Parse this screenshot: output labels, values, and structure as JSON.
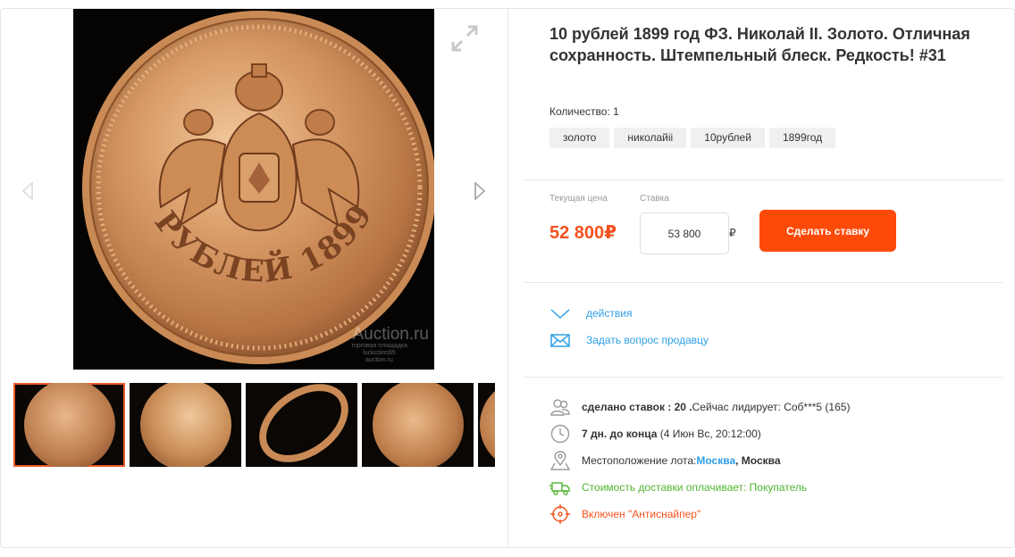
{
  "lot": {
    "title": "10 рублей 1899 год ФЗ. Николай II. Золото. Отличная сохранность. Штемпельный блеск. Редкость! #31",
    "quantity_label": "Количество: 1",
    "tags": [
      "золото",
      "николайii",
      "10рублей",
      "1899год"
    ]
  },
  "photo": {
    "coin_legend": "10 РУБЛЕЙ 1899 Г.",
    "watermark": "Auction.ru",
    "watermark_sub1": "торговая площадка",
    "watermark_sub2": "luckcoins95",
    "watermark_sub3": "auction.ru"
  },
  "bidding": {
    "current_price_label": "Текущая цена",
    "bid_label": "Ставка",
    "current_price": "52 800₽",
    "bid_value": "53 800",
    "currency_sign": "₽",
    "bid_button": "Сделать ставку"
  },
  "actions": {
    "actions_link": "действия",
    "ask_seller": "Задать вопрос продавцу"
  },
  "details": {
    "bids_count": "сделано ставок : 20 .",
    "leader": "Сейчас лидирует: Соб***5 (165)",
    "time_left": "7 дн. до конца",
    "end_date": "(4 Июн Вс, 20:12:00)",
    "location_label": "Местоположение лота:",
    "location_region": "Москва",
    "location_city": ", Москва",
    "shipping": "Стоимость доставки оплачивает: Покупатель",
    "antisniper": "Включен \"Антиснайпер\""
  },
  "colors": {
    "accent": "#fe4a09",
    "price": "#f4511e",
    "link": "#2f9fe4",
    "shipping": "#52b530",
    "thumb_active": "#f05a28"
  },
  "icons": [
    "expand-icon",
    "chevron-left-icon",
    "chevron-right-icon",
    "chevron-down-icon",
    "envelope-icon",
    "users-icon",
    "clock-icon",
    "location-pin-icon",
    "truck-icon",
    "crosshair-icon"
  ]
}
